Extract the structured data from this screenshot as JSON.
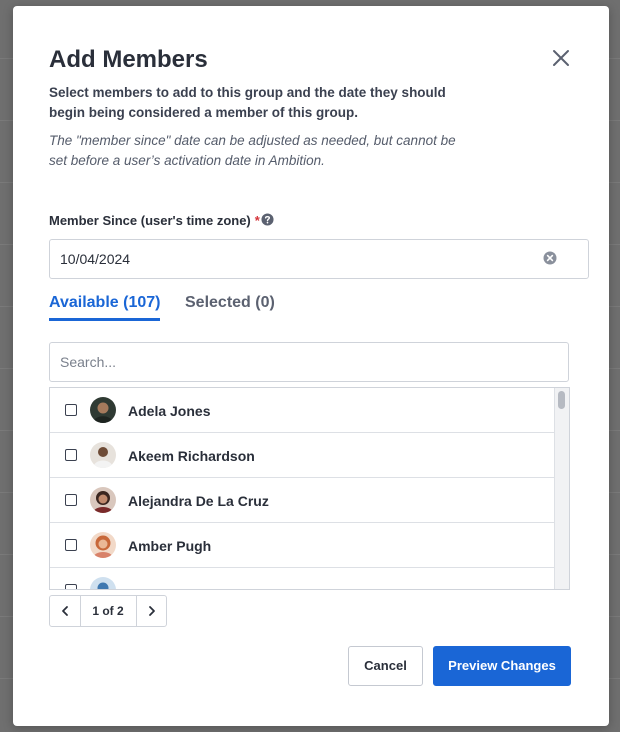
{
  "modal": {
    "title": "Add Members",
    "description": "Select members to add to this group and the date they should begin being considered a member of this group.",
    "note": "The \"member since\" date can be adjusted as needed, but cannot be set before a user’s activation date in Ambition.",
    "field_label": "Member Since (user's time zone)",
    "required_mark": "*",
    "date_value": "10/04/2024",
    "tabs": [
      {
        "label": "Available (107)",
        "active": true
      },
      {
        "label": "Selected (0)",
        "active": false
      }
    ],
    "search_placeholder": "Search...",
    "members": [
      {
        "name": "Adela Jones",
        "checked": false
      },
      {
        "name": "Akeem Richardson",
        "checked": false
      },
      {
        "name": "Alejandra De La Cruz",
        "checked": false
      },
      {
        "name": "Amber Pugh",
        "checked": false
      }
    ],
    "pagination": "1 of 2",
    "cancel_label": "Cancel",
    "preview_label": "Preview Changes"
  },
  "colors": {
    "primary": "#1a66d6",
    "required": "#d4343a",
    "overlay": "#6f6f6f"
  },
  "icons": [
    "close-icon",
    "help-icon",
    "clear-icon",
    "chevron-left-icon",
    "chevron-right-icon"
  ]
}
